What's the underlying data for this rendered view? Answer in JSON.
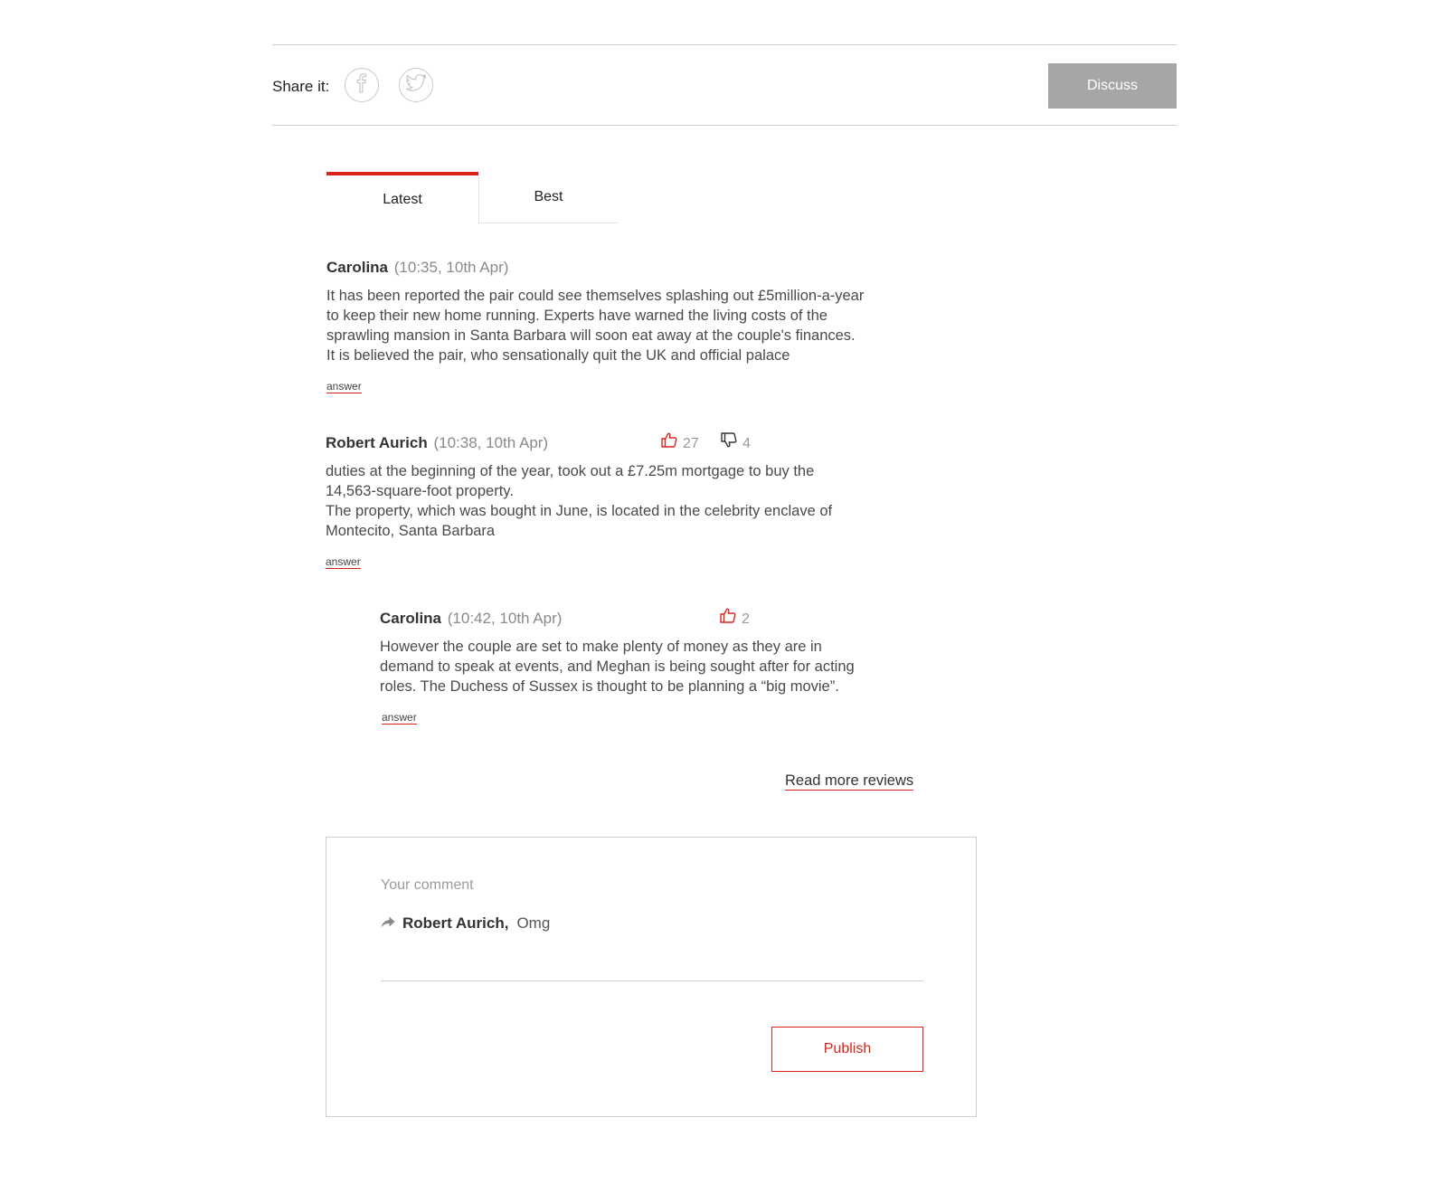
{
  "share": {
    "label": "Share it:",
    "icons": [
      "facebook-icon",
      "twitter-icon"
    ],
    "discuss_label": "Discuss"
  },
  "tabs": [
    {
      "label": "Latest",
      "active": true
    },
    {
      "label": "Best",
      "active": false
    }
  ],
  "comments": [
    {
      "author": "Carolina",
      "time": "(10:35, 10th Apr)",
      "body": "It has been reported the pair could see themselves splashing out £5million-a-year\nto keep their new home running. Experts have warned the living costs of the\nsprawling mansion in Santa Barbara will soon eat away at the couple's finances.\nIt is believed the pair, who sensationally quit the UK and official palace",
      "answer": "answer"
    },
    {
      "author": "Robert Aurich",
      "time": "(10:38, 10th Apr)",
      "likes": "27",
      "dislikes": "4",
      "body": "duties at the beginning of the year, took out a £7.25m mortgage to buy the\n14,563-square-foot property.\nThe property, which was bought in June, is located in the celebrity enclave of\nMontecito, Santa Barbara",
      "answer": "answer"
    },
    {
      "author": "Carolina",
      "time": "(10:42, 10th Apr)",
      "likes": "2",
      "body": "However the couple are set to make plenty of money as they are in\ndemand to speak at events, and Meghan is being sought after for acting\nroles. The Duchess of Sussex is thought to be planning a “big movie”.",
      "answer": "answer"
    }
  ],
  "read_more": "Read more reviews",
  "form": {
    "placeholder": "Your comment",
    "reply_author": "Robert Aurich,",
    "reply_text": "Omg",
    "publish_label": "Publish"
  },
  "colors": {
    "accent": "#d8231c",
    "discuss_bg": "#a6a6a6",
    "muted": "#8a8a8a"
  }
}
